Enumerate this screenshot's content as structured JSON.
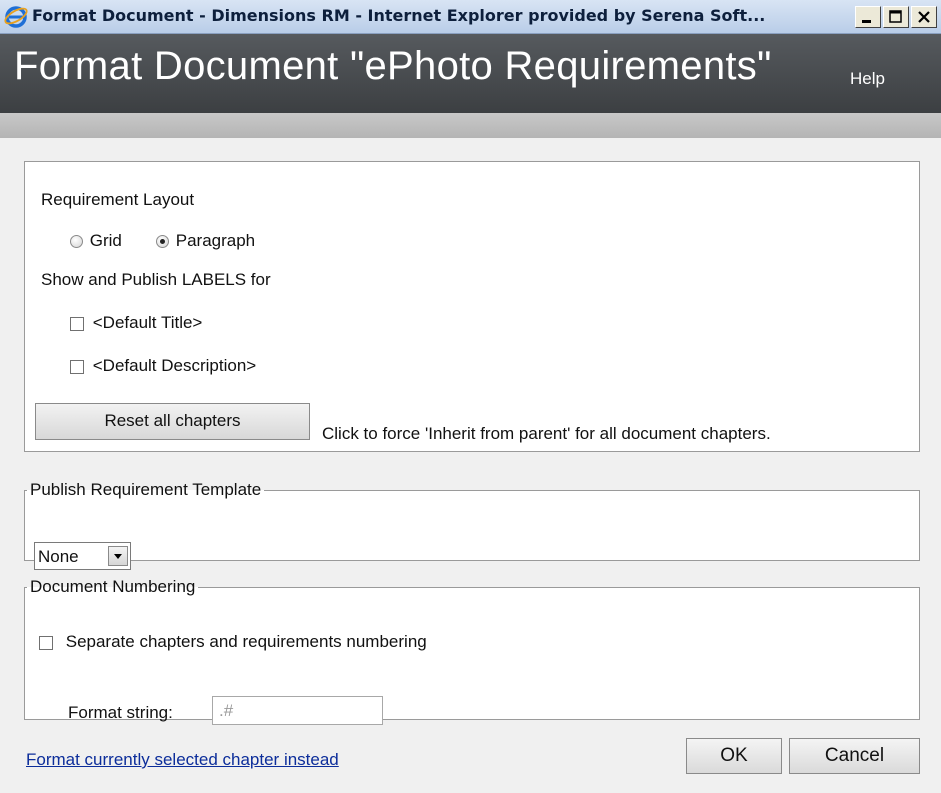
{
  "window": {
    "title": "Format Document - Dimensions RM - Internet Explorer provided by Serena Soft...",
    "minimize_icon": "minimize-icon",
    "maximize_icon": "maximize-icon",
    "close_icon": "close-icon"
  },
  "header": {
    "title": "Format Document \"ePhoto Requirements\"",
    "help": "Help"
  },
  "layout": {
    "label": "Requirement Layout",
    "options": [
      {
        "label": "Grid",
        "selected": false
      },
      {
        "label": "Paragraph",
        "selected": true
      }
    ]
  },
  "labels": {
    "heading": "Show and Publish LABELS for",
    "items": [
      {
        "label": "<Default Title>",
        "checked": false
      },
      {
        "label": "<Default Description>",
        "checked": false
      }
    ]
  },
  "reset": {
    "button": "Reset all chapters",
    "hint": "Click to force 'Inherit from parent' for all document chapters."
  },
  "template": {
    "legend": "Publish Requirement Template",
    "selected": "None"
  },
  "numbering": {
    "legend": "Document Numbering",
    "separate_label": "Separate chapters and requirements numbering",
    "separate_checked": false,
    "format_label": "Format string:",
    "format_placeholder": ".#"
  },
  "footer": {
    "link": "Format currently selected chapter instead",
    "ok": "OK",
    "cancel": "Cancel"
  },
  "colors": {
    "header_bg": "#4a4d50",
    "link": "#0c2d9a"
  }
}
